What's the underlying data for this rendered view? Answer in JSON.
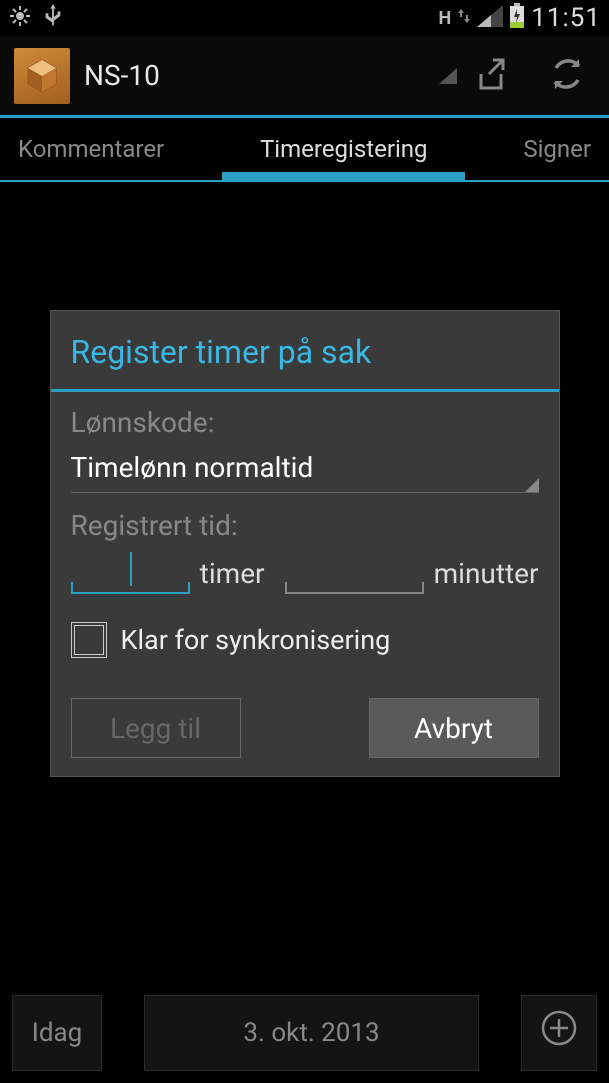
{
  "status": {
    "network_label": "H",
    "clock": "11:51"
  },
  "actionbar": {
    "title": "NS-10"
  },
  "tabs": {
    "left": "Kommentarer",
    "active": "Timeregistering",
    "right": "Signer"
  },
  "dialog": {
    "title": "Register timer på sak",
    "field_wagecode_label": "Lønnskode:",
    "wagecode_value": "Timelønn normaltid",
    "field_time_label": "Registrert tid:",
    "hours_value": "",
    "minutes_value": "",
    "hours_unit": "timer",
    "minutes_unit": "minutter",
    "checkbox_label": "Klar for synkronisering",
    "checkbox_checked": false,
    "button_add": "Legg til",
    "button_cancel": "Avbryt"
  },
  "bottombar": {
    "today": "Idag",
    "date": "3. okt. 2013"
  }
}
